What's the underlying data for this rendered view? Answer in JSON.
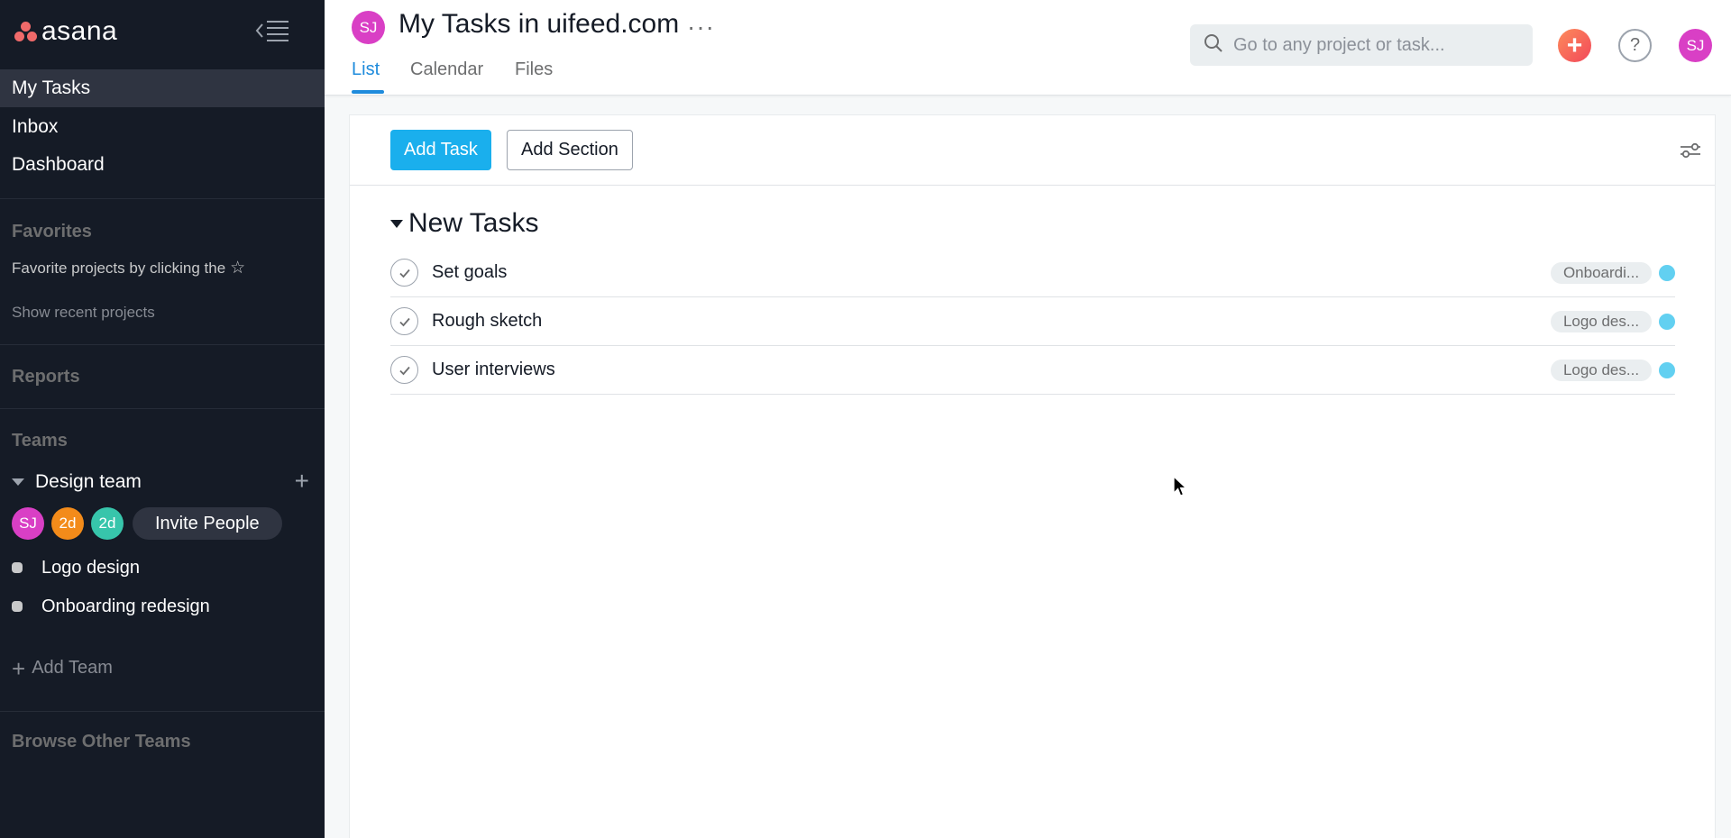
{
  "sidebar": {
    "logo_text": "asana",
    "nav": [
      "My Tasks",
      "Inbox",
      "Dashboard"
    ],
    "favorites": {
      "title": "Favorites",
      "hint": "Favorite projects by clicking the",
      "show_recent": "Show recent projects"
    },
    "reports": "Reports",
    "teams": {
      "title": "Teams",
      "team_name": "Design team",
      "members": [
        {
          "initials": "SJ",
          "color": "#d93fc5"
        },
        {
          "initials": "2d",
          "color": "#f38b1a"
        },
        {
          "initials": "2d",
          "color": "#37c5ab"
        }
      ],
      "invite_label": "Invite People",
      "projects": [
        "Logo design",
        "Onboarding redesign"
      ]
    },
    "add_team": "Add Team",
    "browse_teams": "Browse Other Teams"
  },
  "header": {
    "project_avatar": "SJ",
    "title": "My Tasks in uifeed.com",
    "more": "···",
    "tabs": [
      "List",
      "Calendar",
      "Files"
    ],
    "active_tab": "List",
    "search_placeholder": "Go to any project or task...",
    "help": "?",
    "user_initials": "SJ",
    "quick_add": "+"
  },
  "toolbar": {
    "add_task": "Add Task",
    "add_section": "Add Section"
  },
  "section": {
    "title": "New Tasks",
    "tasks": [
      {
        "name": "Set goals",
        "project": "Onboardi..."
      },
      {
        "name": "Rough sketch",
        "project": "Logo des..."
      },
      {
        "name": "User interviews",
        "project": "Logo des..."
      }
    ]
  },
  "colors": {
    "sidebar_bg": "#151b26",
    "accent_blue": "#1aafed",
    "tab_blue": "#1e8bdc",
    "avatar_pink": "#d93fc5",
    "brand_coral": "#f06a6a",
    "task_dot": "#62d0f1"
  },
  "icons": [
    "asana-logo-icon",
    "collapse-sidebar-icon",
    "star-icon",
    "chevron-down-icon",
    "plus-icon",
    "search-icon",
    "help-icon",
    "more-icon",
    "check-icon",
    "filter-icon",
    "cursor-icon"
  ]
}
